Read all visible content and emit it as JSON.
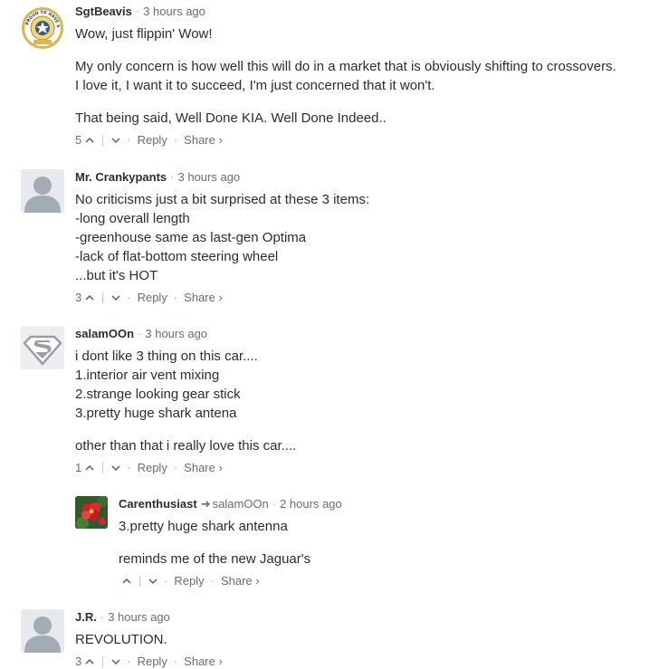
{
  "comments": [
    {
      "author": "SgtBeavis",
      "time": "3 hours ago",
      "paragraphs": [
        [
          "Wow, just flippin' Wow!"
        ],
        [
          "My only concern is how well this will do in a market that is obviously shifting to crossovers.",
          "I love it, I want it to succeed, I'm just concerned that it won't."
        ],
        [
          "That being said, Well Done KIA. Well Done Indeed.."
        ]
      ],
      "upvotes": "5",
      "reply_label": "Reply",
      "share_label": "Share ›",
      "avatar_icon": "army-seal-icon",
      "avatar_text": "PROUD TO HAVE SERVED"
    },
    {
      "author": "Mr. Crankypants",
      "time": "3 hours ago",
      "paragraphs": [
        [
          "No criticisms just a bit surprised at these 3 items:",
          "-long overall length",
          "-greenhouse same as last-gen Optima",
          "-lack of flat-bottom steering wheel",
          "...but it's HOT"
        ]
      ],
      "upvotes": "3",
      "reply_label": "Reply",
      "share_label": "Share ›",
      "avatar_icon": "default-user-icon"
    },
    {
      "author": "salamOOn",
      "time": "3 hours ago",
      "paragraphs": [
        [
          "i dont like 3 thing on this car....",
          "1.interior air vent mixing",
          "2.strange looking gear stick",
          "3.pretty huge shark antena"
        ],
        [
          "other than that i really love this car...."
        ]
      ],
      "upvotes": "1",
      "reply_label": "Reply",
      "share_label": "Share ›",
      "avatar_icon": "superman-logo-icon"
    },
    {
      "author": "Carenthusiast",
      "reply_to": "salamOOn",
      "time": "2 hours ago",
      "paragraphs": [
        [
          "3.pretty huge shark antenna"
        ],
        [
          "reminds me of the new Jaguar's"
        ]
      ],
      "upvotes": "",
      "reply_label": "Reply",
      "share_label": "Share ›",
      "avatar_icon": "red-flower-icon"
    },
    {
      "author": "J.R.",
      "time": "3 hours ago",
      "paragraphs": [
        [
          "REVOLUTION."
        ]
      ],
      "upvotes": "3",
      "reply_label": "Reply",
      "share_label": "Share ›",
      "avatar_icon": "default-user-icon"
    }
  ],
  "colors": {
    "text": "#2a2e2e",
    "meta": "#656c7a",
    "separator": "#a5aaae",
    "avatar_bg": "#e7e9ee",
    "avatar_fg": "#a2acb4"
  }
}
